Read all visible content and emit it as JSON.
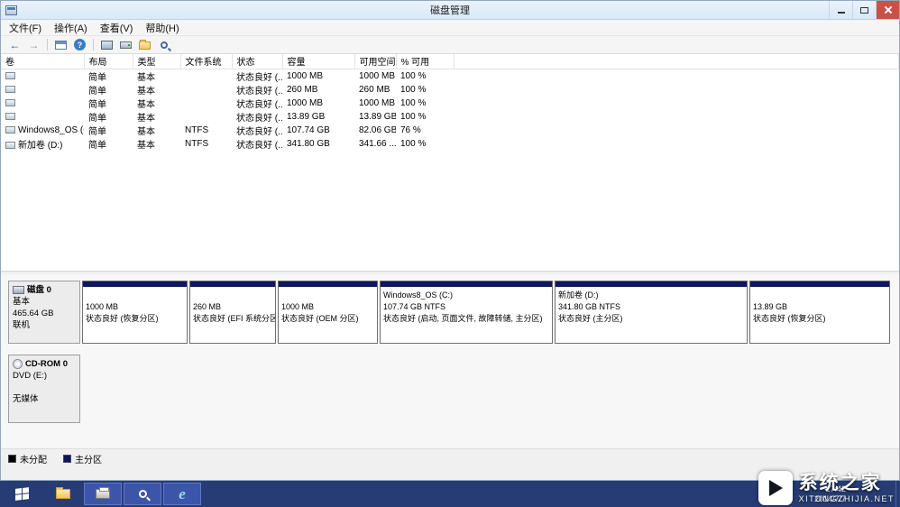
{
  "window": {
    "title": "磁盘管理"
  },
  "menu": {
    "items": [
      "文件(F)",
      "操作(A)",
      "查看(V)",
      "帮助(H)"
    ]
  },
  "toolbar": {
    "icons": [
      "back-icon",
      "forward-icon",
      "console-tree-icon",
      "help-icon",
      "show-icon",
      "disk-icon",
      "folder-icon",
      "search-icon"
    ]
  },
  "volume_table": {
    "columns": [
      "卷",
      "布局",
      "类型",
      "文件系统",
      "状态",
      "容量",
      "可用空间",
      "% 可用"
    ],
    "rows": [
      {
        "volume": "",
        "layout": "简单",
        "type": "基本",
        "fs": "",
        "status": "状态良好 (...",
        "capacity": "1000 MB",
        "free": "1000 MB",
        "pct": "100 %"
      },
      {
        "volume": "",
        "layout": "简单",
        "type": "基本",
        "fs": "",
        "status": "状态良好 (...",
        "capacity": "260 MB",
        "free": "260 MB",
        "pct": "100 %"
      },
      {
        "volume": "",
        "layout": "简单",
        "type": "基本",
        "fs": "",
        "status": "状态良好 (...",
        "capacity": "1000 MB",
        "free": "1000 MB",
        "pct": "100 %"
      },
      {
        "volume": "",
        "layout": "简单",
        "type": "基本",
        "fs": "",
        "status": "状态良好 (...",
        "capacity": "13.89 GB",
        "free": "13.89 GB",
        "pct": "100 %"
      },
      {
        "volume": "Windows8_OS (C:)",
        "layout": "简单",
        "type": "基本",
        "fs": "NTFS",
        "status": "状态良好 (...",
        "capacity": "107.74 GB",
        "free": "82.06 GB",
        "pct": "76 %"
      },
      {
        "volume": "新加卷 (D:)",
        "layout": "简单",
        "type": "基本",
        "fs": "NTFS",
        "status": "状态良好 (...",
        "capacity": "341.80 GB",
        "free": "341.66 ...",
        "pct": "100 %"
      }
    ]
  },
  "disk0": {
    "name": "磁盘 0",
    "type": "基本",
    "size": "465.64 GB",
    "status": "联机",
    "partitions": [
      {
        "title": "",
        "line1": "1000 MB",
        "line2": "状态良好 (恢复分区)"
      },
      {
        "title": "",
        "line1": "260 MB",
        "line2": "状态良好 (EFI 系统分区)"
      },
      {
        "title": "",
        "line1": "1000 MB",
        "line2": "状态良好 (OEM 分区)"
      },
      {
        "title": "Windows8_OS (C:)",
        "line1": "107.74 GB NTFS",
        "line2": "状态良好 (启动, 页面文件, 故障转储, 主分区)"
      },
      {
        "title": "新加卷 (D:)",
        "line1": "341.80 GB NTFS",
        "line2": "状态良好 (主分区)"
      },
      {
        "title": "",
        "line1": "13.89 GB",
        "line2": "状态良好 (恢复分区)"
      }
    ]
  },
  "cdrom": {
    "name": "CD-ROM 0",
    "drive": "DVD (E:)",
    "status": "无媒体"
  },
  "legend": {
    "unallocated": "未分配",
    "primary": "主分区"
  },
  "taskbar": {
    "icons": [
      "start",
      "file-explorer",
      "printer",
      "search",
      "internet-explorer"
    ],
    "tray_time": "17:42",
    "tray_date": "2014/7/7"
  },
  "watermark": {
    "title": "系统之家",
    "subtitle": "XITONGZHIJIA.NET"
  },
  "colors": {
    "primary_partition": "#0d1660",
    "unallocated": "#000000",
    "taskbar": "#273c74",
    "close_button": "#c85148"
  }
}
